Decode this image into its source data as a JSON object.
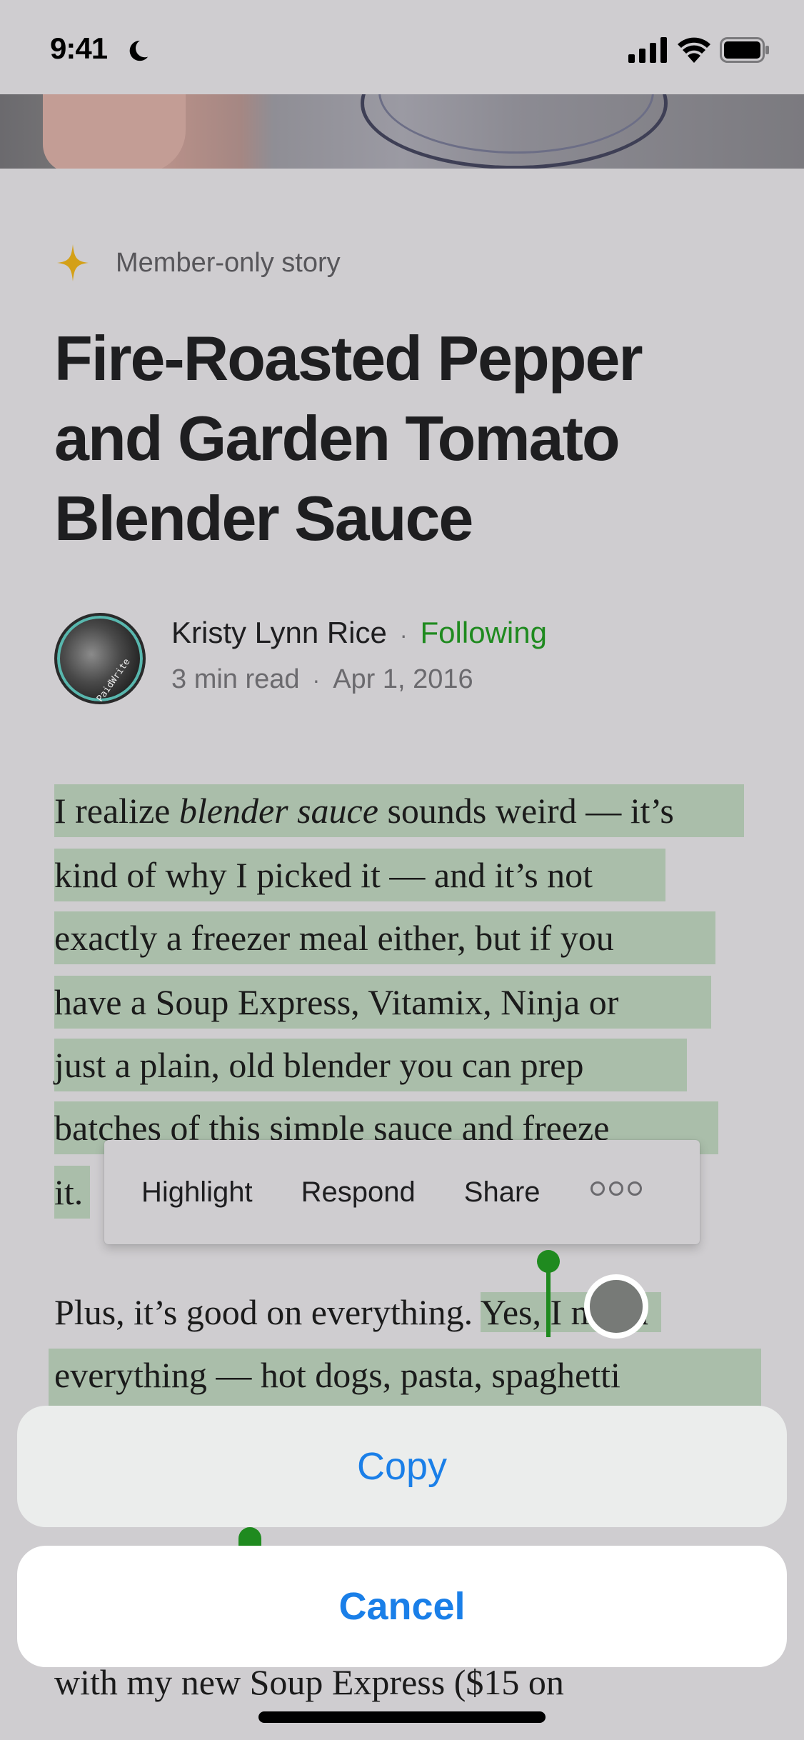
{
  "status_bar": {
    "time": "9:41",
    "focus_icon": "moon-icon",
    "signal_icon": "cellular-signal-icon",
    "wifi_icon": "wifi-icon",
    "battery_icon": "battery-icon"
  },
  "article": {
    "badge_icon": "member-star-icon",
    "badge_color": "#d4a017",
    "member_label": "Member-only story",
    "title": "Fire-Roasted Pepper and Garden Tomato Blender Sauce",
    "author": {
      "name": "Kristy Lynn Rice",
      "separator": "·",
      "follow_status": "Following",
      "follow_color": "#1f8a1f",
      "read_time": "3  min read",
      "date": "Apr 1, 2016",
      "avatar_watermark": "PaidWrite"
    },
    "paragraph1_lines": [
      {
        "pre": "I realize ",
        "em": "blender sauce",
        "post": " sounds weird — it’s"
      },
      {
        "pre": "kind of why I picked it — and it’s not"
      },
      {
        "pre": "exactly a freezer meal either, but if you"
      },
      {
        "pre": "have a Soup Express, Vitamix, Ninja or"
      },
      {
        "pre": "just a plain, old blender you can prep"
      },
      {
        "pre": "batches of this simple sauce and freeze"
      },
      {
        "pre": "it."
      }
    ],
    "paragraph2_lines": [
      {
        "pre": "Plus, it’s good on everything. ",
        "sel": "Yes, I mean"
      },
      {
        "pre": "everything — hot dogs, pasta, spaghetti"
      }
    ],
    "trailing_line": "with my new Soup Express ($15 on",
    "highlight_color": "#aabeaa"
  },
  "selection_menu": {
    "items": [
      "Highlight",
      "Respond",
      "Share"
    ],
    "more_icon": "more-options-icon"
  },
  "action_sheet": {
    "copy_label": "Copy",
    "cancel_label": "Cancel",
    "accent_color": "#1a7fe8"
  }
}
